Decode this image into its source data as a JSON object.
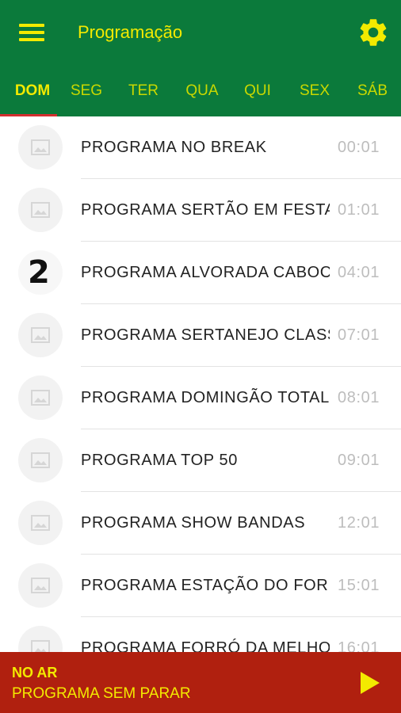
{
  "appbar": {
    "title": "Programação",
    "menu_icon": "hamburger-menu-icon",
    "settings_icon": "gear-icon",
    "accent_color": "#f3ea00",
    "background_color": "#0b7a3b"
  },
  "tabs": [
    {
      "label": "DOM",
      "active": true
    },
    {
      "label": "SEG",
      "active": false
    },
    {
      "label": "TER",
      "active": false
    },
    {
      "label": "QUA",
      "active": false
    },
    {
      "label": "QUI",
      "active": false
    },
    {
      "label": "SEX",
      "active": false
    },
    {
      "label": "SÁB",
      "active": false
    }
  ],
  "schedule": [
    {
      "name": "PROGRAMA NO BREAK",
      "time": "00:01",
      "thumb": "image-placeholder-icon"
    },
    {
      "name": "PROGRAMA SERTÃO EM FESTA",
      "time": "01:01",
      "thumb": "image-placeholder-icon"
    },
    {
      "name": "PROGRAMA ALVORADA CABOCLA",
      "time": "04:01",
      "thumb": "number-2-logo"
    },
    {
      "name": "PROGRAMA SERTANEJO CLASSE A",
      "time": "07:01",
      "thumb": "image-placeholder-icon"
    },
    {
      "name": "PROGRAMA DOMINGÃO TOTAL",
      "time": "08:01",
      "thumb": "image-placeholder-icon"
    },
    {
      "name": "PROGRAMA TOP 50",
      "time": "09:01",
      "thumb": "image-placeholder-icon"
    },
    {
      "name": "PROGRAMA SHOW BANDAS",
      "time": "12:01",
      "thumb": "image-placeholder-icon"
    },
    {
      "name": "PROGRAMA ESTAÇÃO DO FORRÓ",
      "time": "15:01",
      "thumb": "image-placeholder-icon"
    },
    {
      "name": "PROGRAMA FORRÓ DA MELHOR",
      "time": "16:01",
      "thumb": "image-placeholder-icon"
    }
  ],
  "thumb_number": "2",
  "now_playing": {
    "label": "NO AR",
    "program": "PROGRAMA SEM PARAR",
    "play_icon": "play-icon",
    "background_color": "#b0200f"
  }
}
